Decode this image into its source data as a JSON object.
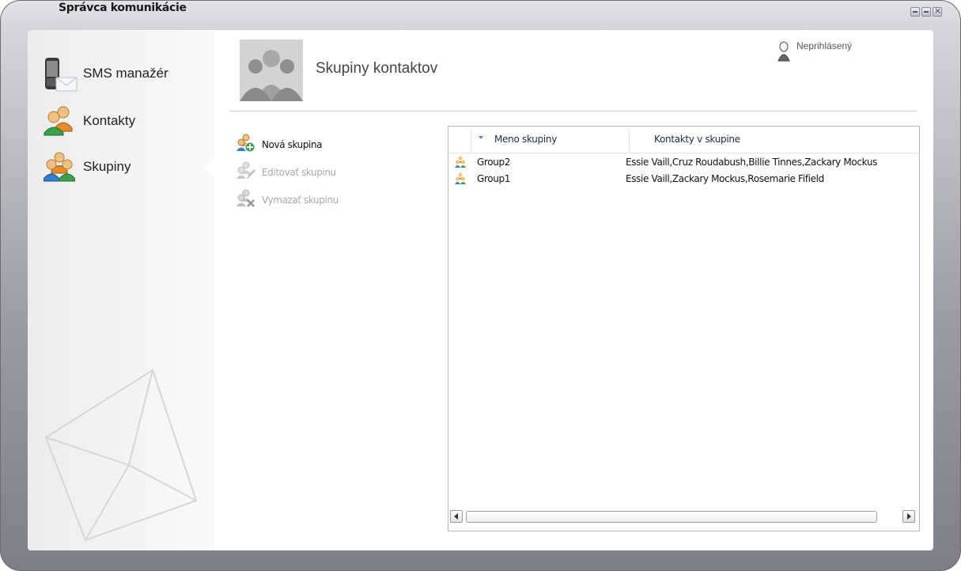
{
  "window": {
    "title": "Správca komunikácie"
  },
  "sidebar": {
    "items": [
      {
        "label": "SMS manažér",
        "icon": "phone-envelope-icon"
      },
      {
        "label": "Kontakty",
        "icon": "contacts-icon"
      },
      {
        "label": "Skupiny",
        "icon": "groups-icon",
        "selected": true
      }
    ]
  },
  "header": {
    "title": "Skupiny kontaktov",
    "user_status": "Neprihlásený"
  },
  "actions": [
    {
      "label": "Nová skupina",
      "enabled": true
    },
    {
      "label": "Editovať skupinu",
      "enabled": false
    },
    {
      "label": "Vymazať skupinu",
      "enabled": false
    }
  ],
  "grid": {
    "columns": [
      "Meno skupiny",
      "Kontakty v skupine"
    ],
    "rows": [
      {
        "name": "Group2",
        "contacts": "Essie Vaill,Cruz Roudabush,Billie Tinnes,Zackary Mockus"
      },
      {
        "name": "Group1",
        "contacts": "Essie Vaill,Zackary Mockus,Rosemarie Fifield"
      }
    ]
  },
  "colors": {
    "accent": "#5a8ac6",
    "divider": "#c8d2e2"
  }
}
